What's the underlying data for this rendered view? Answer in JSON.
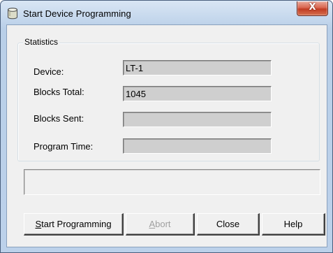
{
  "window": {
    "title": "Start Device Programming",
    "close_glyph": "X"
  },
  "statistics": {
    "legend": "Statistics",
    "fields": [
      {
        "label": "Device:",
        "value": "LT-1"
      },
      {
        "label": "Blocks Total:",
        "value": "1045"
      },
      {
        "label": "Blocks Sent:",
        "value": ""
      },
      {
        "label": "Program Time:",
        "value": ""
      }
    ]
  },
  "status": {
    "text": ""
  },
  "buttons": {
    "start": {
      "mnemonic": "S",
      "rest": "tart Programming"
    },
    "abort": {
      "mnemonic": "A",
      "rest": "bort",
      "enabled": false
    },
    "close": "Close",
    "help": "Help"
  },
  "colors": {
    "title_gradient": "#c3d6ec",
    "close_button": "#c13c22",
    "dialog_bg": "#f0f0f0",
    "readonly_field": "#cfcfcf",
    "disabled_text": "#a0a0a0"
  },
  "icons": {
    "app": "database-cylinder-icon",
    "close": "close-x-icon"
  }
}
